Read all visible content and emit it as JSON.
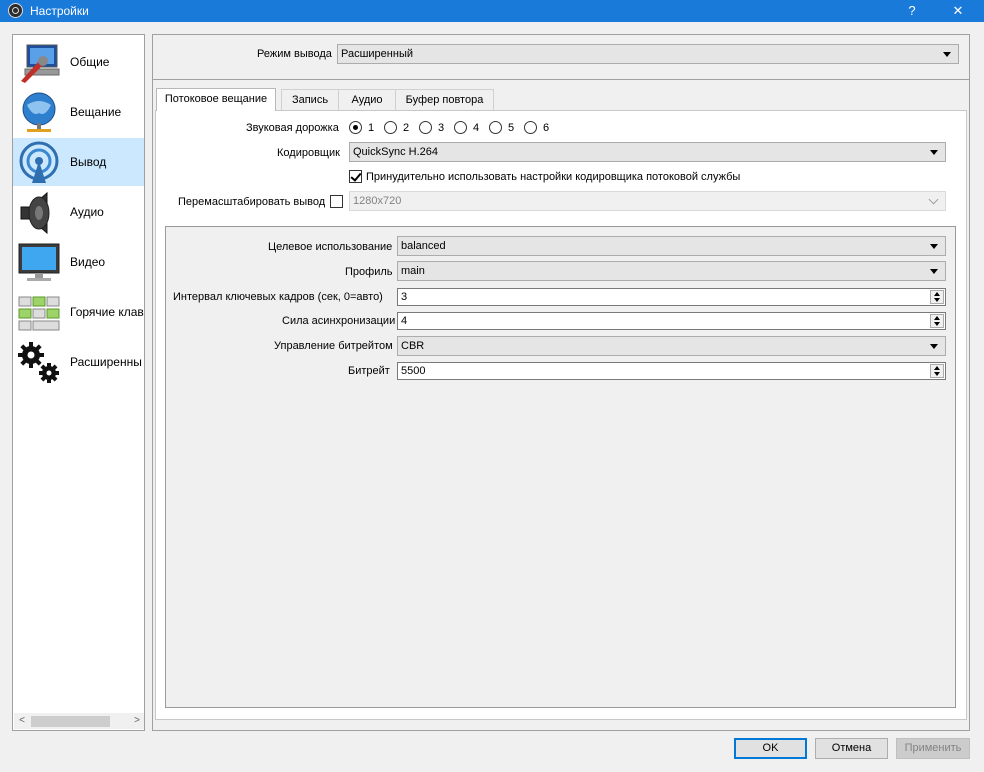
{
  "window": {
    "title": "Настройки",
    "help_label": "?",
    "close_label": "✕",
    "accent": "#1a7ad9"
  },
  "sidebar": {
    "items": [
      {
        "label": "Общие",
        "icon": "general-icon"
      },
      {
        "label": "Вещание",
        "icon": "broadcast-icon"
      },
      {
        "label": "Вывод",
        "icon": "output-icon",
        "selected": true
      },
      {
        "label": "Аудио",
        "icon": "speaker-icon"
      },
      {
        "label": "Видео",
        "icon": "monitor-icon"
      },
      {
        "label": "Горячие клав",
        "icon": "hotkeys-icon"
      },
      {
        "label": "Расширенны",
        "icon": "gears-icon"
      }
    ],
    "scroll_left": "<",
    "scroll_right": ">"
  },
  "output_mode": {
    "label": "Режим вывода",
    "value": "Расширенный"
  },
  "tabs": [
    {
      "label": "Потоковое вещание",
      "active": true
    },
    {
      "label": "Запись"
    },
    {
      "label": "Аудио"
    },
    {
      "label": "Буфер повтора"
    }
  ],
  "streaming": {
    "audio_track_label": "Звуковая дорожка",
    "audio_tracks": [
      "1",
      "2",
      "3",
      "4",
      "5",
      "6"
    ],
    "audio_track_selected": "1",
    "encoder_label": "Кодировщик",
    "encoder_value": "QuickSync H.264",
    "enforce_label": "Принудительно использовать настройки кодировщика потоковой службы",
    "enforce_checked": true,
    "rescale_label": "Перемасштабировать вывод",
    "rescale_checked": false,
    "rescale_value": "1280x720"
  },
  "encoder_settings": {
    "target_usage_label": "Целевое использование",
    "target_usage_value": "balanced",
    "profile_label": "Профиль",
    "profile_value": "main",
    "keyframe_label": "Интервал ключевых кадров (сек, 0=авто)",
    "keyframe_value": "3",
    "async_depth_label": "Сила асинхронизации",
    "async_depth_value": "4",
    "rate_control_label": "Управление битрейтом",
    "rate_control_value": "CBR",
    "bitrate_label": "Битрейт",
    "bitrate_value": "5500"
  },
  "buttons": {
    "ok": "OK",
    "cancel": "Отмена",
    "apply": "Применить"
  }
}
